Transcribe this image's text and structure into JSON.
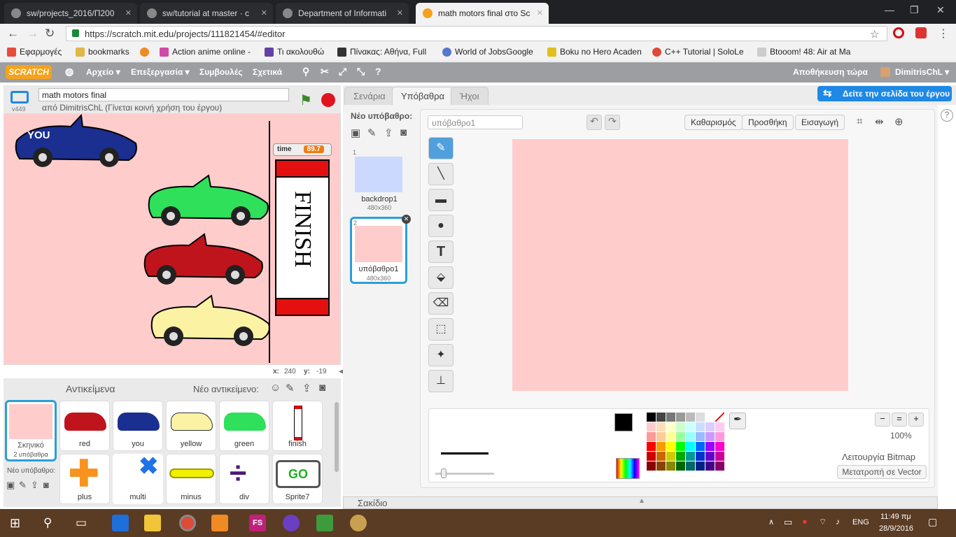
{
  "browser": {
    "tabs": [
      {
        "title": "sw/projects_2016/Π200"
      },
      {
        "title": "sw/tutorial at master · c"
      },
      {
        "title": "Department of Informati"
      },
      {
        "title": "math motors final στο Sc",
        "active": true
      }
    ],
    "url": "https://scratch.mit.edu/projects/111821454/#editor",
    "bookmarks": [
      {
        "label": "Εφαρμογές",
        "color": "#e74c3c"
      },
      {
        "label": "bookmarks",
        "color": "#e0b84a"
      },
      {
        "label": "",
        "color": "#f08a24"
      },
      {
        "label": "Action anime online -",
        "color": "#d04aa6"
      },
      {
        "label": "Τι ακολουθώ",
        "color": "#6441a5"
      },
      {
        "label": "Πίνακας: Αθήνα, Full",
        "color": "#333333"
      },
      {
        "label": "World of JobsGoogle",
        "color": "#5577cc"
      },
      {
        "label": "Boku no Hero Acaden",
        "color": "#e0c020"
      },
      {
        "label": "C++ Tutorial | SoloLe",
        "color": "#dd4b39"
      },
      {
        "label": "Btooom! 48: Air at Ma",
        "color": "#cccccc"
      }
    ]
  },
  "scratch": {
    "logo": "SCRATCH",
    "menu": [
      "Αρχείο ▾",
      "Επεξεργασία ▾",
      "Συμβουλές",
      "Σχετικά"
    ],
    "save": "Αποθήκευση τώρα",
    "user": "DimitrisChL ▾",
    "project": {
      "title": "math motors final",
      "version": "v449",
      "author": "από DimitrisChL (Γίνεται κοινή χρήση του έργου)"
    },
    "stage": {
      "timer_label": "time",
      "timer_value": "89.7",
      "you_label": "YOU",
      "finish_text": "FINISH",
      "coord_x_label": "x:",
      "coord_x": "240",
      "coord_y_label": "y:",
      "coord_y": "-19"
    },
    "sprites": {
      "header": "Αντικείμενα",
      "new_label": "Νέο αντικείμενο:",
      "scene_label": "Σκηνικό",
      "scene_sub": "2 υπόβαθρα",
      "new_backdrop": "Νέο υπόβαθρο:",
      "items": [
        {
          "name": "red",
          "color": "#c0141c"
        },
        {
          "name": "you",
          "color": "#1a2f8f"
        },
        {
          "name": "yellow",
          "color": "#fbf2a4"
        },
        {
          "name": "green",
          "color": "#2ee05a"
        },
        {
          "name": "finish",
          "color": "#d01010"
        },
        {
          "name": "plus",
          "color": "#f7931e"
        },
        {
          "name": "multi",
          "color": "#1e73e8"
        },
        {
          "name": "minus",
          "color": "#f0f000"
        },
        {
          "name": "div",
          "color": "#4b1a7a"
        },
        {
          "name": "Sprite7",
          "color": "#20b020"
        }
      ]
    },
    "editor_tabs": [
      "Σενάρια",
      "Υπόβαθρα",
      "Ήχοι"
    ],
    "see_project_page": "Δείτε την σελίδα του έργου",
    "backdrops": {
      "new_label": "Νέο υπόβαθρο:",
      "items": [
        {
          "num": "1",
          "name": "backdrop1",
          "size": "480x360",
          "color": "#ccd9ff"
        },
        {
          "num": "2",
          "name": "υπόβαθρο1",
          "size": "480x360",
          "color": "#ffcccc"
        }
      ]
    },
    "paint": {
      "name_value": "υπόβαθρο1",
      "buttons": [
        "Καθαρισμός",
        "Προσθήκη",
        "Εισαγωγή"
      ],
      "zoom": "100%",
      "mode": "Λειτουργία Bitmap",
      "convert": "Μετατροπή σε Vector",
      "canvas_color": "#ffcccc",
      "palette": [
        "#000000",
        "#444444",
        "#777777",
        "#999999",
        "#bbbbbb",
        "#dddddd",
        "#ffffff",
        "#ffcccc",
        "#ffddbb",
        "#ffffcc",
        "#ccffcc",
        "#ccffff",
        "#ccddff",
        "#ddccff",
        "#ffccee",
        "#ff9999",
        "#ffcc99",
        "#ffff99",
        "#99ff99",
        "#99ffff",
        "#99bbff",
        "#cc99ff",
        "#ff99dd",
        "#ff0000",
        "#ff9900",
        "#ffff00",
        "#00ff00",
        "#00ffff",
        "#0066ff",
        "#9900ff",
        "#ff00cc",
        "#cc0000",
        "#cc6600",
        "#cccc00",
        "#00aa00",
        "#009999",
        "#0033cc",
        "#6600cc",
        "#cc0099",
        "#880000",
        "#884400",
        "#888800",
        "#006600",
        "#006666",
        "#002288",
        "#440088",
        "#880066"
      ]
    },
    "backpack": "Σακίδιο"
  },
  "taskbar": {
    "lang": "ENG",
    "time": "11:49 πμ",
    "date": "28/9/2016"
  }
}
